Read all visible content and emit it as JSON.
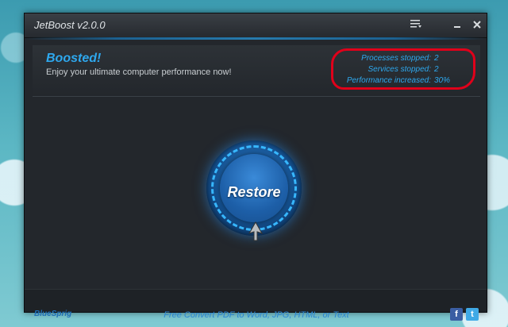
{
  "window": {
    "title": "JetBoost v2.0.0"
  },
  "banner": {
    "status": "Boosted!",
    "message": "Enjoy your ultimate computer performance now!"
  },
  "stats": [
    {
      "label": "Processes stopped:",
      "value": "2"
    },
    {
      "label": "Services stopped:",
      "value": "2"
    },
    {
      "label": "Performance increased:",
      "value": "30%"
    }
  ],
  "main": {
    "button_label": "Restore"
  },
  "footer": {
    "brand": "BlueSprig",
    "promo": "Free Convert PDF to Word, JPG, HTML, or Text",
    "facebook_glyph": "f",
    "twitter_glyph": "t"
  },
  "colors": {
    "accent": "#2ea8ee",
    "highlight_mark": "#e0001a"
  },
  "icons": [
    "menu-icon",
    "minimize-icon",
    "close-icon",
    "facebook-icon",
    "twitter-icon",
    "mouse-cursor-icon"
  ]
}
